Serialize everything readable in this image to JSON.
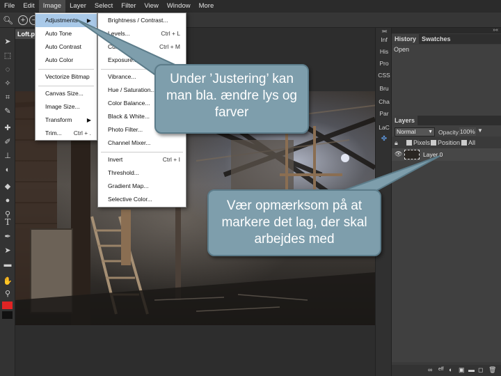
{
  "menubar": {
    "items": [
      "File",
      "Edit",
      "Image",
      "Layer",
      "Select",
      "Filter",
      "View",
      "Window",
      "More"
    ]
  },
  "document": {
    "tab_title": "Loft.psd"
  },
  "image_menu": {
    "items": [
      {
        "label": "Adjustments",
        "submenu": "▶"
      },
      {
        "label": "Auto Tone"
      },
      {
        "label": "Auto Contrast"
      },
      {
        "label": "Auto Color"
      },
      {
        "label": "Vectorize Bitmap"
      },
      {
        "label": "Canvas Size..."
      },
      {
        "label": "Image Size..."
      },
      {
        "label": "Transform",
        "submenu": "▶"
      },
      {
        "label": "Trim...",
        "shortcut": "Ctrl + ."
      }
    ]
  },
  "adjustments_menu": {
    "items": [
      {
        "label": "Brightness / Contrast..."
      },
      {
        "label": "Levels...",
        "shortcut": "Ctrl + L"
      },
      {
        "label": "Curves...",
        "shortcut": "Ctrl + M"
      },
      {
        "label": "Exposure..."
      },
      {
        "label": "Vibrance..."
      },
      {
        "label": "Hue / Saturation..."
      },
      {
        "label": "Color Balance..."
      },
      {
        "label": "Black & White..."
      },
      {
        "label": "Photo Filter..."
      },
      {
        "label": "Channel Mixer..."
      },
      {
        "label": "Invert",
        "shortcut": "Ctrl + I"
      },
      {
        "label": "Threshold..."
      },
      {
        "label": "Gradient Map..."
      },
      {
        "label": "Selective Color..."
      }
    ]
  },
  "side_panel": {
    "items": [
      "Inf",
      "His",
      "Pro",
      "CSS",
      "Bru",
      "Cha",
      "Par",
      "LaC"
    ]
  },
  "history_panel": {
    "tab_history": "History",
    "tab_swatches": "Swatches",
    "entry": "Open"
  },
  "layers_panel": {
    "tab": "Layers",
    "blend_mode": "Normal",
    "opacity_label": "Opacity:",
    "opacity_value": "100%",
    "lock_pixels": "Pixels",
    "lock_position": "Position",
    "lock_all": "All",
    "layer_name": "Layer 0"
  },
  "callouts": {
    "adjust": "Under ’Justering’ kan man bla. ændre lys og farver",
    "layer": "Vær opmærksom på at markere det lag, der skal arbejdes med"
  },
  "colors": {
    "menu_highlight": "#a9c9e8",
    "callout_fill": "#7e9eac",
    "foreground_swatch": "#e02424"
  }
}
